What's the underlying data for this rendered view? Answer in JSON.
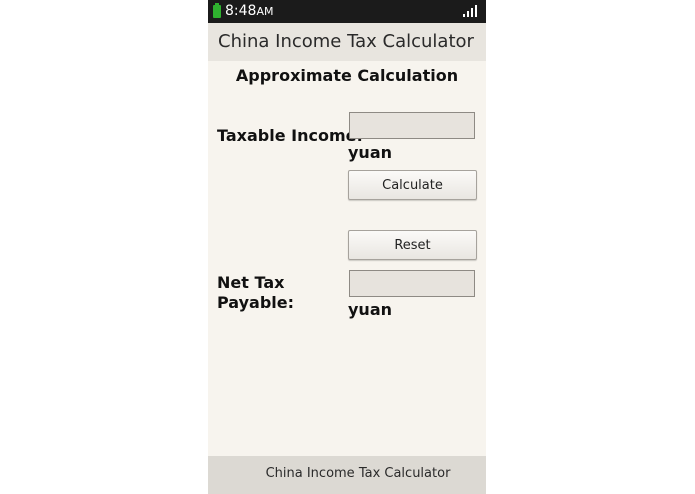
{
  "status_bar": {
    "time": "8:48",
    "ampm": "AM",
    "colors": {
      "bar": "#1b1b1b",
      "battery": "#2fb12f"
    }
  },
  "header": {
    "title": "China Income Tax Calculator"
  },
  "main": {
    "subtitle": "Approximate Calculation",
    "taxable_income": {
      "label": "Taxable Income:",
      "value": "",
      "placeholder": "",
      "unit": "yuan"
    },
    "calculate_label": "Calculate",
    "reset_label": "Reset",
    "net_tax": {
      "label_line1": "Net Tax",
      "label_line2": "Payable:",
      "value": "",
      "placeholder": "",
      "unit": "yuan"
    }
  },
  "footer": {
    "title": "China Income Tax Calculator"
  }
}
